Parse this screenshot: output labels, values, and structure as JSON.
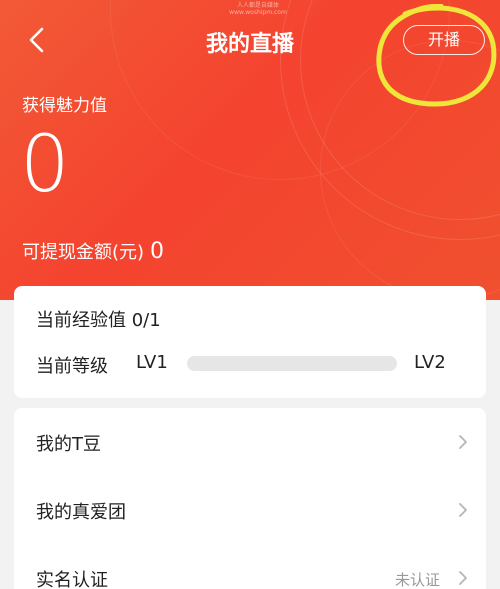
{
  "header": {
    "title": "我的直播",
    "start_live_label": "开播",
    "watermark_line1": "人人都是自媒体",
    "watermark_line2": "www.woshipm.com"
  },
  "charm": {
    "label": "获得魅力值",
    "value": "0"
  },
  "withdraw": {
    "label": "可提现金额(元)",
    "value": "0"
  },
  "experience": {
    "label": "当前经验值 0/1",
    "level_label": "当前等级",
    "current_level": "LV1",
    "next_level": "LV2",
    "progress": 0
  },
  "menu": {
    "items": [
      {
        "label": "我的T豆",
        "status": ""
      },
      {
        "label": "我的真爱团",
        "status": ""
      },
      {
        "label": "实名认证",
        "status": "未认证"
      }
    ]
  },
  "colors": {
    "hero": "#f4432f",
    "highlight": "#f0e63a"
  },
  "icons": {
    "back": "back-arrow-icon",
    "chevron": "chevron-right-icon"
  }
}
